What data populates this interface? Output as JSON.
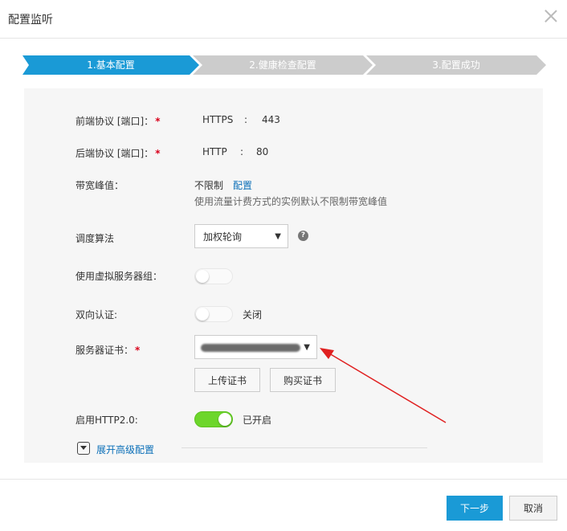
{
  "dialog": {
    "title": "配置监听",
    "close_icon": "close-icon"
  },
  "steps": [
    {
      "label": "1.基本配置",
      "active": true
    },
    {
      "label": "2.健康检查配置",
      "active": false
    },
    {
      "label": "3.配置成功",
      "active": false
    }
  ],
  "form": {
    "frontend": {
      "label": "前端协议 [端口]：",
      "protocol": "HTTPS",
      "sep": ":",
      "port": "443"
    },
    "backend": {
      "label": "后端协议 [端口]：",
      "protocol": "HTTP",
      "sep": ":",
      "port": "80"
    },
    "bandwidth": {
      "label": "带宽峰值：",
      "value": "不限制",
      "link": "配置",
      "hint": "使用流量计费方式的实例默认不限制带宽峰值"
    },
    "scheduler": {
      "label": "调度算法",
      "selected": "加权轮询"
    },
    "vserver_group": {
      "label": "使用虚拟服务器组：",
      "enabled": false
    },
    "mutual_auth": {
      "label": "双向认证:",
      "enabled": false,
      "state_text": "关闭"
    },
    "server_cert": {
      "label": "服务器证书：",
      "upload_label": "上传证书",
      "buy_label": "购买证书"
    },
    "http2": {
      "label": "启用HTTP2.0:",
      "enabled": true,
      "state_text": "已开启"
    },
    "advanced": {
      "label": "展开高级配置"
    }
  },
  "footer": {
    "next_label": "下一步",
    "cancel_label": "取消"
  },
  "colors": {
    "step_active": "#1a9ad6",
    "step_inactive": "#cccccc",
    "required": "#d9001b",
    "toggle_on": "#6dd62b",
    "link": "#0b6fb8",
    "annotation_arrow": "#e02020"
  }
}
